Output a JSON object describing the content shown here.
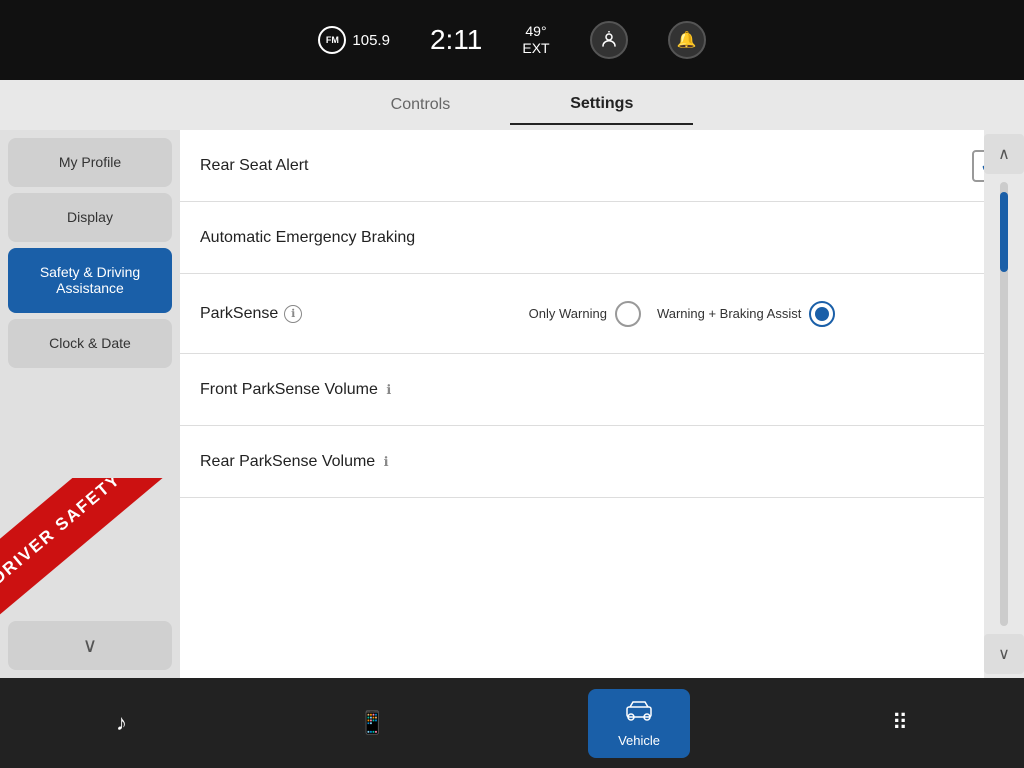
{
  "statusBar": {
    "fm_badge": "FM",
    "fm_station": "105.9",
    "time": "2:11",
    "temp": "49°",
    "temp_unit": "EXT"
  },
  "tabs": {
    "controls_label": "Controls",
    "settings_label": "Settings"
  },
  "sidebar": {
    "my_profile_label": "My Profile",
    "display_label": "Display",
    "safety_label": "Safety & Driving Assistance",
    "clock_label": "Clock & Date",
    "down_icon": "∨"
  },
  "settings": {
    "rear_seat_alert_label": "Rear Seat Alert",
    "aeb_label": "Automatic Emergency Braking",
    "parksense_label": "ParkSense",
    "only_warning_label": "Only Warning",
    "warning_braking_label": "Warning + Braking Assist",
    "front_parksense_label": "Front ParkSense Volume",
    "rear_parksense_label": "Rear ParkSense Volume"
  },
  "bottomNav": {
    "music_label": "Music",
    "phone_label": "Phone",
    "vehicle_label": "Vehicle",
    "apps_label": "Apps"
  },
  "banner": {
    "text": "DRIVER SAFETY ASSIST"
  }
}
